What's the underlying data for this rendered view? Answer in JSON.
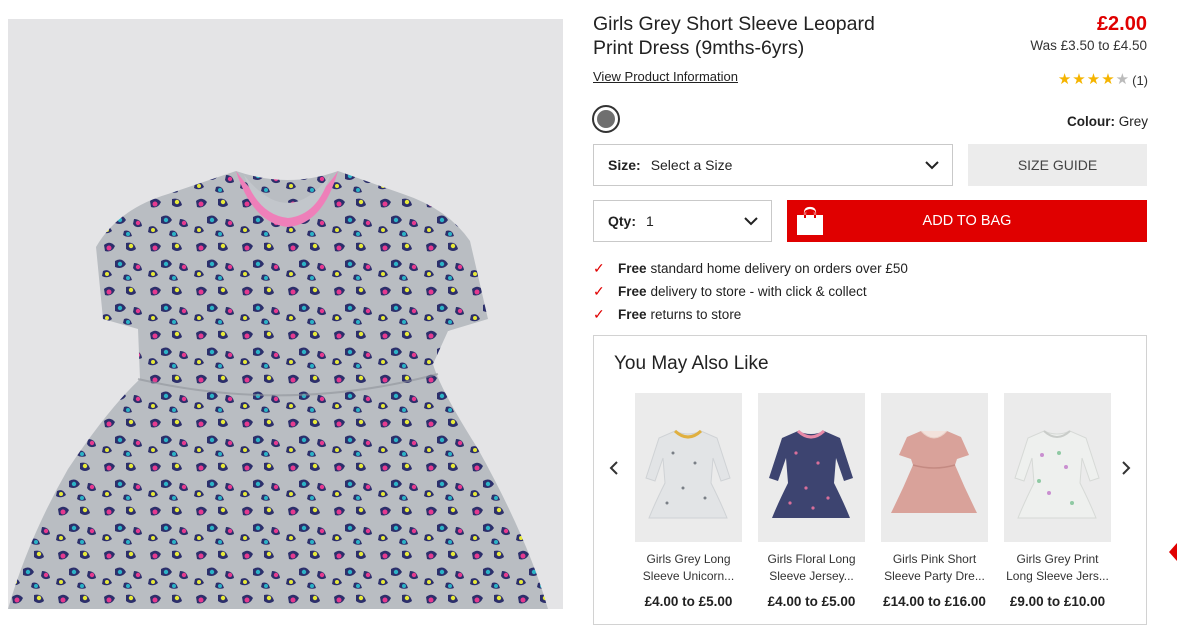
{
  "product": {
    "title_line1": "Girls Grey Short Sleeve Leopard",
    "title_line2": "Print Dress (9mths-6yrs)",
    "price_now": "£2.00",
    "price_was": "Was £3.50 to £4.50",
    "view_info": "View Product Information",
    "rating_value": 4,
    "rating_max": 5,
    "rating_count": "(1)",
    "colour_label": "Colour:",
    "colour_value": "Grey",
    "swatch_color": "#6f6f6f"
  },
  "size": {
    "label": "Size:",
    "value": "Select a Size"
  },
  "qty": {
    "label": "Qty:",
    "value": "1"
  },
  "buttons": {
    "size_guide": "SIZE GUIDE",
    "add_to_bag": "ADD TO BAG"
  },
  "delivery": [
    {
      "bold": "Free",
      "text": "standard home delivery on orders over £50"
    },
    {
      "bold": "Free",
      "text": "delivery to store - with click & collect"
    },
    {
      "bold": "Free",
      "text": "returns to store"
    }
  ],
  "also_like": {
    "title": "You May Also Like",
    "items": [
      {
        "name1": "Girls Grey Long",
        "name2": "Sleeve Unicorn...",
        "price": "£4.00 to £5.00"
      },
      {
        "name1": "Girls Floral Long",
        "name2": "Sleeve Jersey...",
        "price": "£4.00 to £5.00"
      },
      {
        "name1": "Girls Pink Short",
        "name2": "Sleeve Party Dre...",
        "price": "£14.00 to £16.00"
      },
      {
        "name1": "Girls Grey Print",
        "name2": "Long Sleeve Jers...",
        "price": "£9.00 to £10.00"
      }
    ]
  },
  "colors": {
    "accent_red": "#e00000",
    "star": "#f5b400"
  }
}
